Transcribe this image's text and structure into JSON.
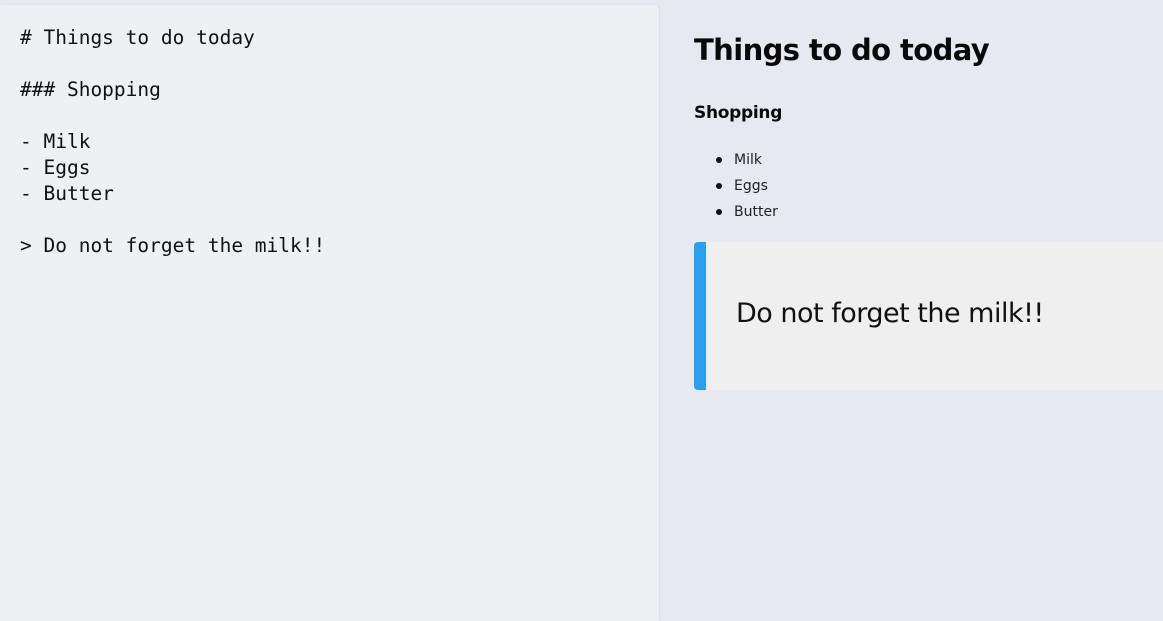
{
  "editor": {
    "lines": [
      "# Things to do today",
      "",
      "### Shopping",
      "",
      "- Milk",
      "- Eggs",
      "- Butter",
      "",
      "> Do not forget the milk!!"
    ]
  },
  "preview": {
    "title": "Things to do today",
    "subheading": "Shopping",
    "items": [
      "Milk",
      "Eggs",
      "Butter"
    ],
    "blockquote": "Do not forget the milk!!"
  },
  "colors": {
    "app_background": "#e7e9f1",
    "editor_background": "#eff0f4",
    "blockquote_border": "#2a9ff0",
    "blockquote_background": "#efefef"
  }
}
